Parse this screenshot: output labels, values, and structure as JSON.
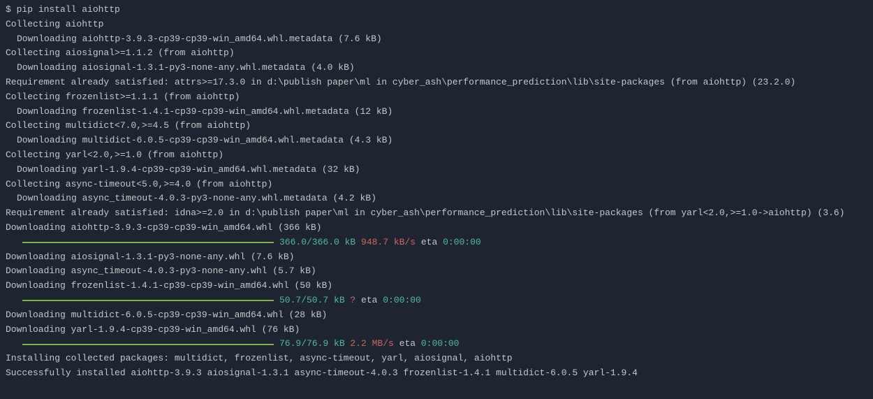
{
  "lines": {
    "cmd_prompt": "$ ",
    "cmd": "pip install aiohttp",
    "l1": "Collecting aiohttp",
    "l2": "Downloading aiohttp-3.9.3-cp39-cp39-win_amd64.whl.metadata (7.6 kB)",
    "l3": "Collecting aiosignal>=1.1.2 (from aiohttp)",
    "l4": "Downloading aiosignal-1.3.1-py3-none-any.whl.metadata (4.0 kB)",
    "l5": "Requirement already satisfied: attrs>=17.3.0 in d:\\publish paper\\ml in cyber_ash\\performance_prediction\\lib\\site-packages (from aiohttp) (23.2.0)",
    "l6": "Collecting frozenlist>=1.1.1 (from aiohttp)",
    "l7": "Downloading frozenlist-1.4.1-cp39-cp39-win_amd64.whl.metadata (12 kB)",
    "l8": "Collecting multidict<7.0,>=4.5 (from aiohttp)",
    "l9": "Downloading multidict-6.0.5-cp39-cp39-win_amd64.whl.metadata (4.3 kB)",
    "l10": "Collecting yarl<2.0,>=1.0 (from aiohttp)",
    "l11": "Downloading yarl-1.9.4-cp39-cp39-win_amd64.whl.metadata (32 kB)",
    "l12": "Collecting async-timeout<5.0,>=4.0 (from aiohttp)",
    "l13": "Downloading async_timeout-4.0.3-py3-none-any.whl.metadata (4.2 kB)",
    "l14": "Requirement already satisfied: idna>=2.0 in d:\\publish paper\\ml in cyber_ash\\performance_prediction\\lib\\site-packages (from yarl<2.0,>=1.0->aiohttp) (3.6)",
    "l15": "Downloading aiohttp-3.9.3-cp39-cp39-win_amd64.whl (366 kB)",
    "p1_size": "366.0/366.0 kB",
    "p1_speed": " 948.7 kB/s",
    "p1_eta": " eta ",
    "p1_time": "0:00:00",
    "l16": "Downloading aiosignal-1.3.1-py3-none-any.whl (7.6 kB)",
    "l17": "Downloading async_timeout-4.0.3-py3-none-any.whl (5.7 kB)",
    "l18": "Downloading frozenlist-1.4.1-cp39-cp39-win_amd64.whl (50 kB)",
    "p2_size": "50.7/50.7 kB",
    "p2_speed": " ?",
    "p2_eta": " eta ",
    "p2_time": "0:00:00",
    "l19": "Downloading multidict-6.0.5-cp39-cp39-win_amd64.whl (28 kB)",
    "l20": "Downloading yarl-1.9.4-cp39-cp39-win_amd64.whl (76 kB)",
    "p3_size": "76.9/76.9 kB",
    "p3_speed": " 2.2 MB/s",
    "p3_eta": " eta ",
    "p3_time": "0:00:00",
    "l21": "Installing collected packages: multidict, frozenlist, async-timeout, yarl, aiosignal, aiohttp",
    "l22": "Successfully installed aiohttp-3.9.3 aiosignal-1.3.1 async-timeout-4.0.3 frozenlist-1.4.1 multidict-6.0.5 yarl-1.9.4"
  }
}
